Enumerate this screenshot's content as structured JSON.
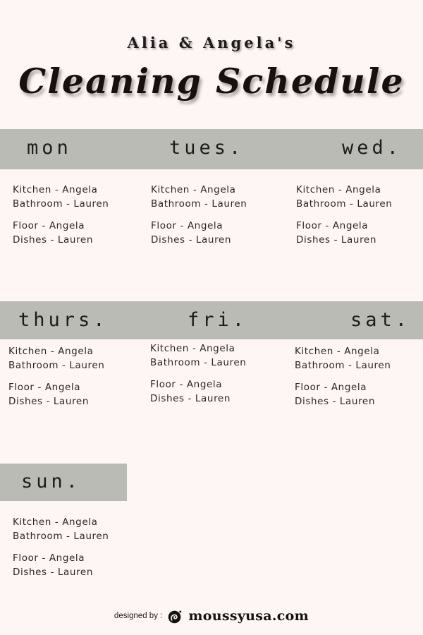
{
  "header": {
    "subtitle": "Alia & Angela's",
    "title": "Cleaning Schedule"
  },
  "colors": {
    "page_background": "#fdf6f5",
    "band_background": "#bbbbb5",
    "text": "#2b2626",
    "heading": "#1c1c1c"
  },
  "schedule": {
    "days": [
      {
        "key": "mon",
        "label": "mon",
        "tasks_group_1": [
          "Kitchen - Angela",
          "Bathroom - Lauren"
        ],
        "tasks_group_2": [
          "Floor - Angela",
          "Dishes - Lauren"
        ]
      },
      {
        "key": "tues",
        "label": "tues.",
        "tasks_group_1": [
          "Kitchen - Angela",
          "Bathroom - Lauren"
        ],
        "tasks_group_2": [
          "Floor - Angela",
          "Dishes - Lauren"
        ]
      },
      {
        "key": "wed",
        "label": "wed.",
        "tasks_group_1": [
          "Kitchen - Angela",
          "Bathroom - Lauren"
        ],
        "tasks_group_2": [
          "Floor - Angela",
          "Dishes - Lauren"
        ]
      },
      {
        "key": "thurs",
        "label": "thurs.",
        "tasks_group_1": [
          "Kitchen - Angela",
          "Bathroom - Lauren"
        ],
        "tasks_group_2": [
          "Floor - Angela",
          "Dishes - Lauren"
        ]
      },
      {
        "key": "fri",
        "label": "fri.",
        "tasks_group_1": [
          "Kitchen - Angela",
          "Bathroom - Lauren"
        ],
        "tasks_group_2": [
          "Floor - Angela",
          "Dishes - Lauren"
        ]
      },
      {
        "key": "sat",
        "label": "sat.",
        "tasks_group_1": [
          "Kitchen - Angela",
          "Bathroom - Lauren"
        ],
        "tasks_group_2": [
          "Floor - Angela",
          "Dishes - Lauren"
        ]
      },
      {
        "key": "sun",
        "label": "sun.",
        "tasks_group_1": [
          "Kitchen - Angela",
          "Bathroom - Lauren"
        ],
        "tasks_group_2": [
          "Floor - Angela",
          "Dishes - Lauren"
        ]
      }
    ]
  },
  "footer": {
    "designed_by_label": "designed by :",
    "logo_icon": "moussy-circle-swirl-logo-icon",
    "brand_name": "moussyusa.com"
  }
}
